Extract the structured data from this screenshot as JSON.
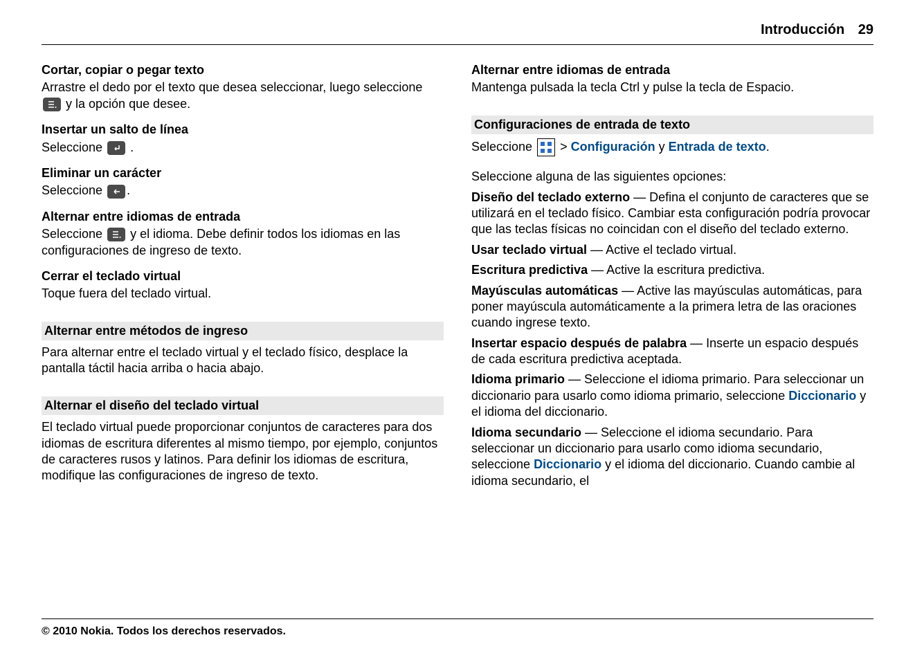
{
  "header": {
    "section": "Introducción",
    "page": "29"
  },
  "left": {
    "s1": {
      "title": "Cortar, copiar o pegar texto",
      "p1a": "Arrastre el dedo por el texto que desea seleccionar, luego seleccione",
      "p1b": "y la opción que desee."
    },
    "s2": {
      "title": "Insertar un salto de línea",
      "p1a": "Seleccione",
      "p1b": "."
    },
    "s3": {
      "title": "Eliminar un carácter",
      "p1a": "Seleccione",
      "p1b": "."
    },
    "s4": {
      "title": "Alternar entre idiomas de entrada",
      "p1a": "Seleccione",
      "p1b": "y el idioma. Debe definir todos los idiomas en las configuraciones de ingreso de texto."
    },
    "s5": {
      "title": "Cerrar el teclado virtual",
      "p1": "Toque fuera del teclado virtual."
    },
    "h1": {
      "title": "Alternar entre métodos de ingreso",
      "p1": "Para alternar entre el teclado virtual y el teclado físico, desplace la pantalla táctil hacia arriba o hacia abajo."
    },
    "h2": {
      "title": "Alternar el diseño del teclado virtual",
      "p1": "El teclado virtual puede proporcionar conjuntos de caracteres para dos idiomas de escritura diferentes al mismo tiempo, por ejemplo, conjuntos de caracteres rusos y latinos. Para definir los idiomas de escritura, modifique las configuraciones de ingreso de texto."
    }
  },
  "right": {
    "s1": {
      "title": "Alternar entre idiomas de entrada",
      "p1": "Mantenga pulsada la tecla Ctrl y pulse la tecla de Espacio."
    },
    "h1": {
      "title": "Configuraciones de entrada de texto",
      "p1a": "Seleccione",
      "p1b": ">",
      "menu1": "Configuración",
      "p1c": "y",
      "menu2": "Entrada de texto",
      "p1d": ".",
      "p2": "Seleccione alguna de las siguientes opciones:"
    },
    "opts": {
      "o1": {
        "label": "Diseño del teclado externo",
        "text": " — Defina el conjunto de caracteres que se utilizará en el teclado físico. Cambiar esta configuración podría provocar que las teclas físicas no coincidan con el diseño del teclado externo."
      },
      "o2": {
        "label": "Usar teclado virtual",
        "text": " — Active el teclado virtual."
      },
      "o3": {
        "label": "Escritura predictiva",
        "text": " — Active la escritura predictiva."
      },
      "o4": {
        "label": "Mayúsculas automáticas",
        "text": " — Active las mayúsculas automáticas, para poner mayúscula automáticamente a la primera letra de las oraciones cuando ingrese texto."
      },
      "o5": {
        "label": "Insertar espacio después de palabra",
        "text": " — Inserte un espacio después de cada escritura predictiva aceptada."
      },
      "o6": {
        "label": "Idioma primario",
        "t1": " — Seleccione el idioma primario. Para seleccionar un diccionario para usarlo como idioma primario, seleccione ",
        "menu": "Diccionario",
        "t2": " y el idioma del diccionario."
      },
      "o7": {
        "label": "Idioma secundario",
        "t1": " — Seleccione el idioma secundario. Para seleccionar un diccionario para usarlo como idioma secundario, seleccione ",
        "menu": "Diccionario",
        "t2": " y el idioma del diccionario. Cuando cambie al idioma secundario, el"
      }
    }
  },
  "footer": "© 2010 Nokia. Todos los derechos reservados."
}
